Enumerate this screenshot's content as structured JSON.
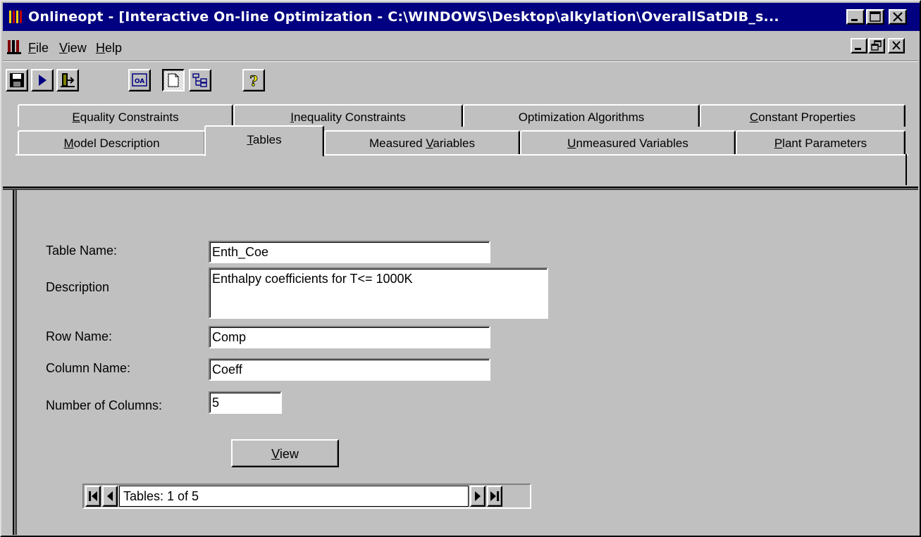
{
  "window": {
    "title": "Onlineopt - [Interactive On-line Optimization - C:\\WINDOWS\\Desktop\\alkylation\\OverallSatDIB_s...",
    "title_bar_color": "#000080"
  },
  "menu": {
    "items": [
      {
        "label": "File",
        "accel": "F",
        "rest": "ile"
      },
      {
        "label": "View",
        "accel": "V",
        "rest": "iew"
      },
      {
        "label": "Help",
        "accel": "H",
        "rest": "elp"
      }
    ]
  },
  "toolbar": {
    "buttons": [
      "save-icon",
      "run-icon",
      "exit-icon",
      "algorithm-icon",
      "blank-page-icon",
      "tree-icon",
      "help-icon"
    ],
    "algorithm_label": "OA",
    "help_glyph": "?"
  },
  "tabs": {
    "row1": [
      {
        "label": "Equality Constraints",
        "accel": "E",
        "rest": "quality Constraints"
      },
      {
        "label": "Inequality Constraints",
        "accel": "I",
        "rest": "nequality Constraints"
      },
      {
        "label": "Optimization Algorithms",
        "accel": "",
        "rest": "Optimization Algorithms"
      },
      {
        "label": "Constant Properties",
        "accel": "C",
        "rest": "onstant Properties"
      }
    ],
    "row2": [
      {
        "label": "Model Description",
        "pre": "",
        "accel": "M",
        "rest": "odel Description"
      },
      {
        "label": "Tables",
        "pre": "",
        "accel": "T",
        "rest": "ables"
      },
      {
        "label": "Measured Variables",
        "pre": "Measured ",
        "accel": "V",
        "rest": "ariables"
      },
      {
        "label": "Unmeasured Variables",
        "pre": "",
        "accel": "U",
        "rest": "nmeasured Variables"
      },
      {
        "label": "Plant Parameters",
        "pre": "",
        "accel": "P",
        "rest": "lant Parameters"
      }
    ],
    "active": "Tables"
  },
  "form": {
    "table_name_label": "Table Name:",
    "table_name_value": "Enth_Coe",
    "description_label": "Description",
    "description_value": "Enthalpy coefficients for T<= 1000K",
    "row_name_label": "Row Name:",
    "row_name_value": "Comp",
    "column_name_label": "Column Name:",
    "column_name_value": "Coeff",
    "num_columns_label": "Number of Columns:",
    "num_columns_value": "5",
    "view_button": {
      "accel": "V",
      "rest": "iew"
    }
  },
  "navigator": {
    "record_text": "Tables: 1 of 5"
  }
}
